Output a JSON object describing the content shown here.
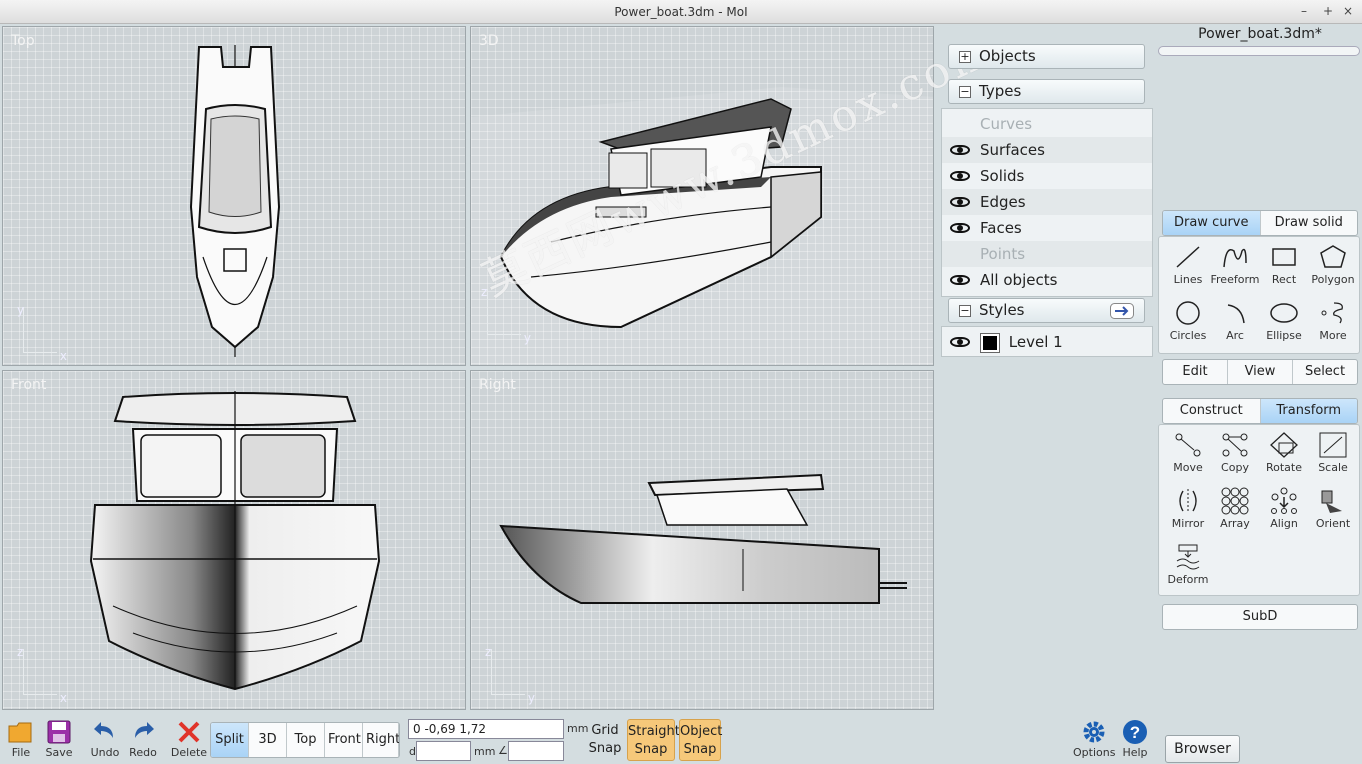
{
  "window": {
    "title": "Power_boat.3dm - MoI",
    "min": "–",
    "max": "+",
    "close": "×"
  },
  "viewports": {
    "top": "Top",
    "three_d": "3D",
    "front": "Front",
    "right": "Right"
  },
  "axes": {
    "x": "x",
    "y": "y",
    "z": "z"
  },
  "watermark": "莫西网www.3dmox.com",
  "scene_panel": {
    "objects": "Objects",
    "types": "Types",
    "type_items": [
      {
        "label": "Curves",
        "visible": false
      },
      {
        "label": "Surfaces",
        "visible": true
      },
      {
        "label": "Solids",
        "visible": true
      },
      {
        "label": "Edges",
        "visible": true
      },
      {
        "label": "Faces",
        "visible": true
      },
      {
        "label": "Points",
        "visible": false
      },
      {
        "label": "All objects",
        "visible": true
      }
    ],
    "styles": "Styles",
    "level": "Level 1",
    "level_color": "#000000"
  },
  "right_panel": {
    "filename": "Power_boat.3dm*",
    "draw_tabs": [
      "Draw curve",
      "Draw solid"
    ],
    "draw_tools": [
      "Lines",
      "Freeform",
      "Rect",
      "Polygon",
      "Circles",
      "Arc",
      "Ellipse",
      "More"
    ],
    "mid_tabs": [
      "Edit",
      "View",
      "Select"
    ],
    "transform_tabs": [
      "Construct",
      "Transform"
    ],
    "transform_tools": [
      "Move",
      "Copy",
      "Rotate",
      "Scale",
      "Mirror",
      "Array",
      "Align",
      "Orient",
      "Deform"
    ],
    "subd": "SubD"
  },
  "bottom": {
    "file": "File",
    "save": "Save",
    "undo": "Undo",
    "redo": "Redo",
    "delete": "Delete",
    "views": [
      "Split",
      "3D",
      "Top",
      "Front",
      "Right"
    ],
    "coord_value": "0        -0,69    1,72",
    "unit": "mm",
    "d_label": "d",
    "d_unit": "mm",
    "angle_sym": "∠",
    "grid_snap": "Grid Snap",
    "straight_snap": "Straight Snap",
    "object_snap": "Object Snap",
    "options": "Options",
    "help": "Help",
    "browser": "Browser"
  },
  "colors": {
    "accent": "#1a5fb4",
    "highlight": "#f6c87a",
    "delete": "#e0342a",
    "tab_active": "#b8dcf8"
  }
}
